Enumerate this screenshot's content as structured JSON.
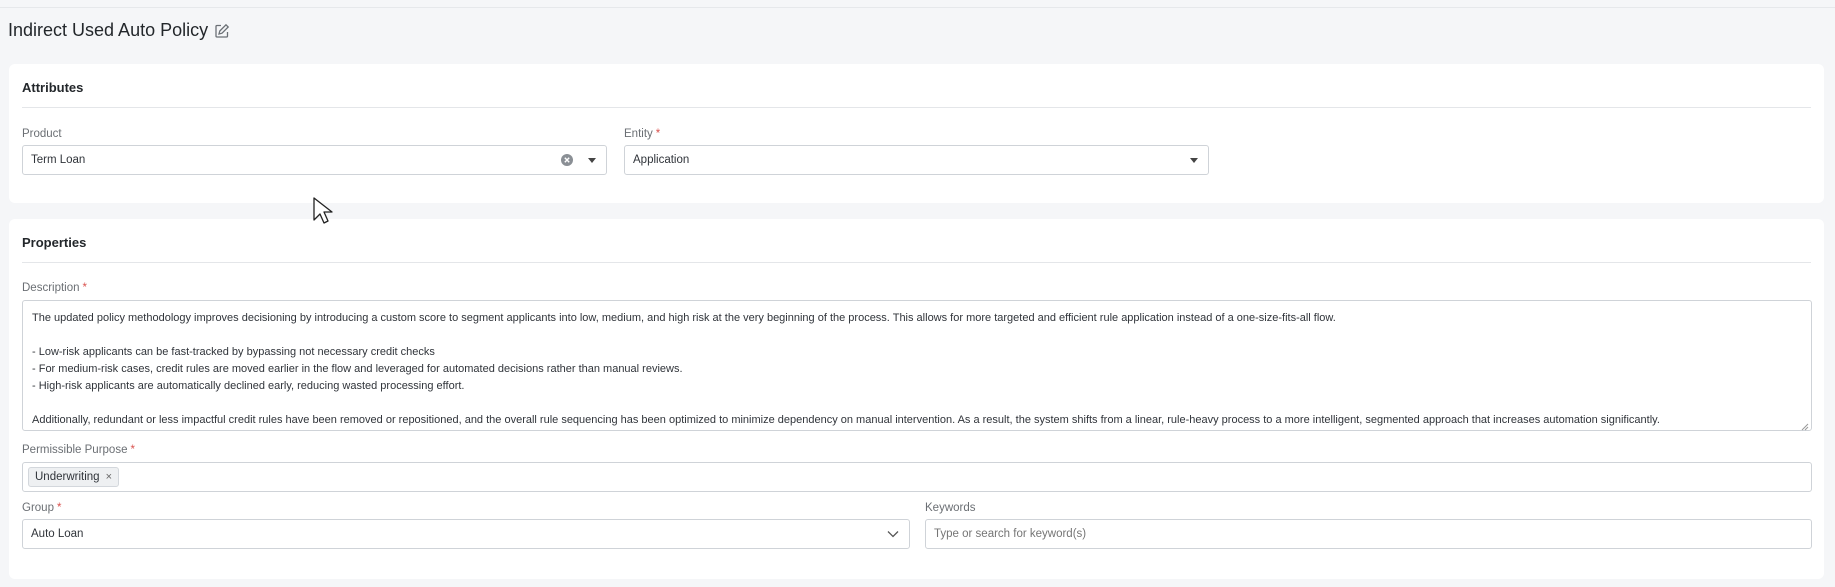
{
  "page": {
    "title": "Indirect Used Auto Policy"
  },
  "icons": {
    "edit": "edit-icon",
    "clear": "clear-circle-icon",
    "dropdown": "caret-down-icon",
    "chevron": "chevron-down-icon",
    "remove_tag": "close-icon",
    "cursor": "mouse-pointer"
  },
  "attributes": {
    "title": "Attributes",
    "product": {
      "label": "Product",
      "value": "Term Loan"
    },
    "entity": {
      "label": "Entity",
      "required": "*",
      "value": "Application"
    }
  },
  "properties": {
    "title": "Properties",
    "description": {
      "label": "Description",
      "required": "*",
      "lines": [
        "The updated policy methodology improves decisioning by introducing a custom score to segment applicants into low, medium, and high risk at the very beginning of the process. This allows for more targeted and efficient rule application instead of a one-size-fits-all flow.",
        "",
        "- Low-risk applicants can be fast-tracked by bypassing not necessary credit checks",
        "- For medium-risk cases, credit rules are moved earlier in the flow and leveraged for automated decisions rather than manual reviews.",
        "- High-risk applicants are automatically declined early, reducing wasted processing effort.",
        "",
        "Additionally, redundant or less impactful credit rules have been removed or repositioned, and the overall rule sequencing has been optimized to minimize dependency on manual intervention. As a result, the system shifts from a linear, rule-heavy process to a more intelligent, segmented approach that increases automation significantly."
      ]
    },
    "permissible_purpose": {
      "label": "Permissible Purpose",
      "required": "*",
      "tags": [
        "Underwriting"
      ],
      "remove_glyph": "×"
    },
    "group": {
      "label": "Group",
      "required": "*",
      "value": "Auto Loan"
    },
    "keywords": {
      "label": "Keywords",
      "placeholder": "Type or search for keyword(s)"
    }
  },
  "colors": {
    "background": "#f5f6f8",
    "card": "#ffffff",
    "required": "#d9534f",
    "border": "#cfd3d8"
  }
}
